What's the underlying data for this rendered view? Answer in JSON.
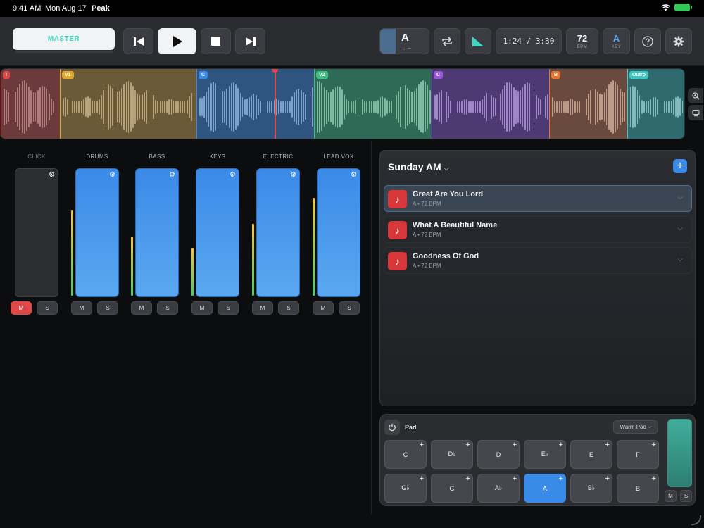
{
  "status": {
    "time": "9:41 AM",
    "date": "Mon Aug 17",
    "app": "Peak"
  },
  "toolbar": {
    "master_label": "MASTER",
    "key_current": "A",
    "key_next": "→ –",
    "time": "1:24 / 3:30",
    "bpm": "72",
    "bpm_label": "BPM",
    "key": "A",
    "key_label": "KEY"
  },
  "timeline": {
    "sections": [
      {
        "label": "I",
        "color": "#e04848"
      },
      {
        "label": "V1",
        "color": "#e0a82e"
      },
      {
        "label": "C",
        "color": "#3a8ae8"
      },
      {
        "label": "V2",
        "color": "#3fbf7f"
      },
      {
        "label": "C",
        "color": "#9a5ad8"
      },
      {
        "label": "B",
        "color": "#e8742e"
      },
      {
        "label": "Outro",
        "color": "#3fc6c0"
      }
    ],
    "playhead_percent": 40
  },
  "mixer": {
    "channels": [
      {
        "name": "CLICK",
        "level": 0,
        "muted": true,
        "enabled": false
      },
      {
        "name": "DRUMS",
        "level": 0.67,
        "muted": false,
        "enabled": true
      },
      {
        "name": "BASS",
        "level": 0.47,
        "muted": false,
        "enabled": true
      },
      {
        "name": "KEYS",
        "level": 0.38,
        "muted": false,
        "enabled": true
      },
      {
        "name": "ELECTRIC",
        "level": 0.57,
        "muted": false,
        "enabled": true
      },
      {
        "name": "LEAD VOX",
        "level": 0.77,
        "muted": false,
        "enabled": true
      }
    ],
    "mute_label": "M",
    "solo_label": "S"
  },
  "setlist": {
    "title": "Sunday AM",
    "songs": [
      {
        "name": "Great Are You Lord",
        "meta": "A • 72 BPM"
      },
      {
        "name": "What A Beautiful Name",
        "meta": "A • 72 BPM"
      },
      {
        "name": "Goodness Of God",
        "meta": "A • 72 BPM"
      }
    ]
  },
  "pad": {
    "label": "Pad",
    "preset": "Warm Pad",
    "keys": [
      "C",
      "D♭",
      "D",
      "E♭",
      "E",
      "F",
      "G♭",
      "G",
      "A♭",
      "A",
      "B♭",
      "B"
    ],
    "selected": "A",
    "mute_label": "M",
    "solo_label": "S"
  },
  "colors": {
    "accent": "#3a8ae8",
    "mute": "#e04848",
    "master_text": "#3fd5c1",
    "pad_volume": "#3fae9a"
  }
}
